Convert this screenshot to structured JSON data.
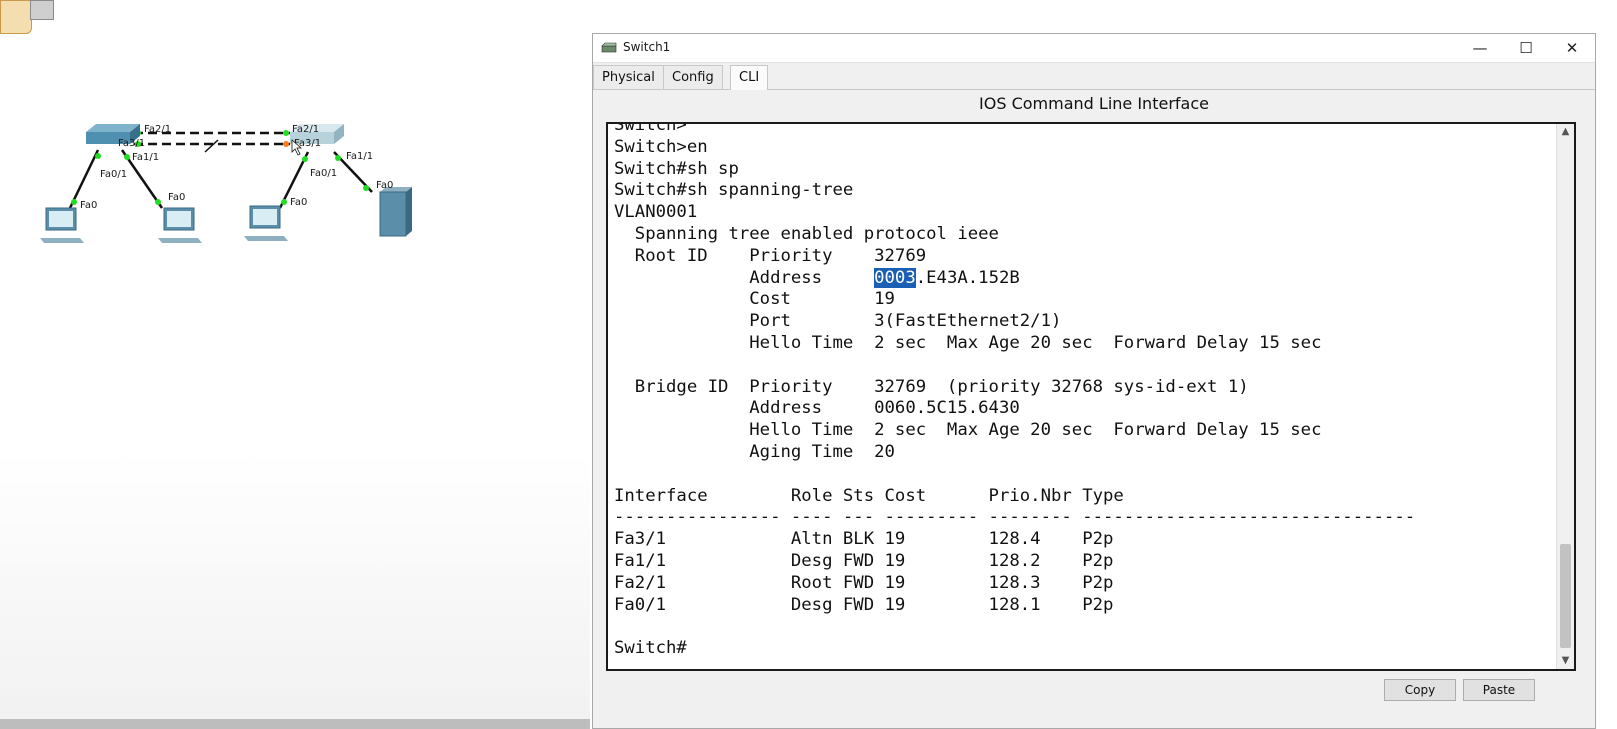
{
  "window": {
    "title": "Switch1",
    "controls": {
      "minimize": "—",
      "maximize": "☐",
      "close": "✕"
    }
  },
  "tabs": [
    {
      "label": "Physical",
      "active": false
    },
    {
      "label": "Config",
      "active": false
    },
    {
      "label": "CLI",
      "active": true
    }
  ],
  "cli": {
    "heading": "IOS Command Line Interface",
    "lines_before": [
      "Switch>",
      "Switch>en",
      "Switch#sh sp",
      "Switch#sh spanning-tree",
      "VLAN0001",
      "  Spanning tree enabled protocol ieee",
      "  Root ID    Priority    32769"
    ],
    "root_address_prefix": "             Address     ",
    "root_address_selected": "0003",
    "root_address_suffix": ".E43A.152B",
    "lines_after": [
      "             Cost        19",
      "             Port        3(FastEthernet2/1)",
      "             Hello Time  2 sec  Max Age 20 sec  Forward Delay 15 sec",
      "",
      "  Bridge ID  Priority    32769  (priority 32768 sys-id-ext 1)",
      "             Address     0060.5C15.6430",
      "             Hello Time  2 sec  Max Age 20 sec  Forward Delay 15 sec",
      "             Aging Time  20",
      "",
      "Interface        Role Sts Cost      Prio.Nbr Type",
      "---------------- ---- --- --------- -------- --------------------------------",
      "Fa3/1            Altn BLK 19        128.4    P2p",
      "Fa1/1            Desg FWD 19        128.2    P2p",
      "Fa2/1            Root FWD 19        128.3    P2p",
      "Fa0/1            Desg FWD 19        128.1    P2p",
      "",
      "Switch#"
    ],
    "scroll_up": "▲",
    "scroll_down": "▼"
  },
  "buttons": {
    "copy": "Copy",
    "paste": "Paste"
  },
  "topology": {
    "labels": {
      "sw1_fa21": "Fa2/1",
      "sw1_fa31": "Fa3/1",
      "sw1_fa11": "Fa1/1",
      "sw1_fa01": "Fa0/1",
      "sw2_fa21": "Fa2/1",
      "sw2_fa31": "Fa3/1",
      "sw2_fa11": "Fa1/1",
      "sw2_fa01": "Fa0/1",
      "pc0_fa0": "Fa0",
      "pc1_fa0": "Fa0",
      "pc2_fa0": "Fa0",
      "server_fa0": "Fa0"
    }
  },
  "colors": {
    "link_up": "#22dd22",
    "link_blocked": "#ff7a1a",
    "selection": "#1a5fb4",
    "switch_body": "#4f8fb0"
  }
}
